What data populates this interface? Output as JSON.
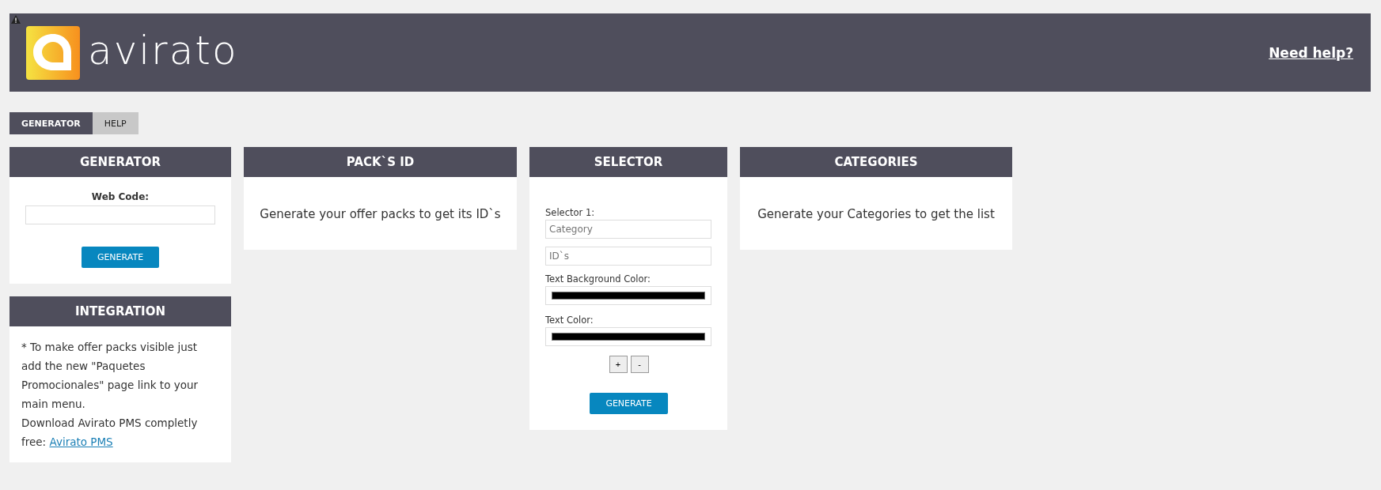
{
  "header": {
    "logo_text": "avirato",
    "help_link": "Need help?",
    "warning": true
  },
  "tabs": [
    {
      "label": "GENERATOR",
      "selected": true
    },
    {
      "label": "HELP",
      "selected": false
    }
  ],
  "generator": {
    "title": "GENERATOR",
    "label": "Web Code:",
    "button": "GENERATE"
  },
  "integration": {
    "title": "INTEGRATION",
    "paragraphs": [
      {
        "text": "* To make offer packs visible just add the new \"Paquetes Promocionales\" page link to your main menu."
      },
      {
        "text": "Download Avirato PMS completly free:",
        "link": "Avirato PMS"
      }
    ]
  },
  "packs": {
    "title": "PACK`S ID",
    "message": "Generate your offer packs to get its ID`s"
  },
  "selector": {
    "title": "SELECTOR",
    "label": "Selector 1:",
    "category_placeholder": "Category",
    "ids_placeholder": "ID`s",
    "color_fields": [
      {
        "label": "Text Background Color:",
        "color": "#000000"
      },
      {
        "label": "Text Color:",
        "color": "#000000"
      }
    ],
    "add": "+",
    "remove": "-",
    "button": "GENERATE"
  },
  "categories": {
    "title": "CATEGORIES",
    "message": "Generate your Categories to get the list"
  }
}
